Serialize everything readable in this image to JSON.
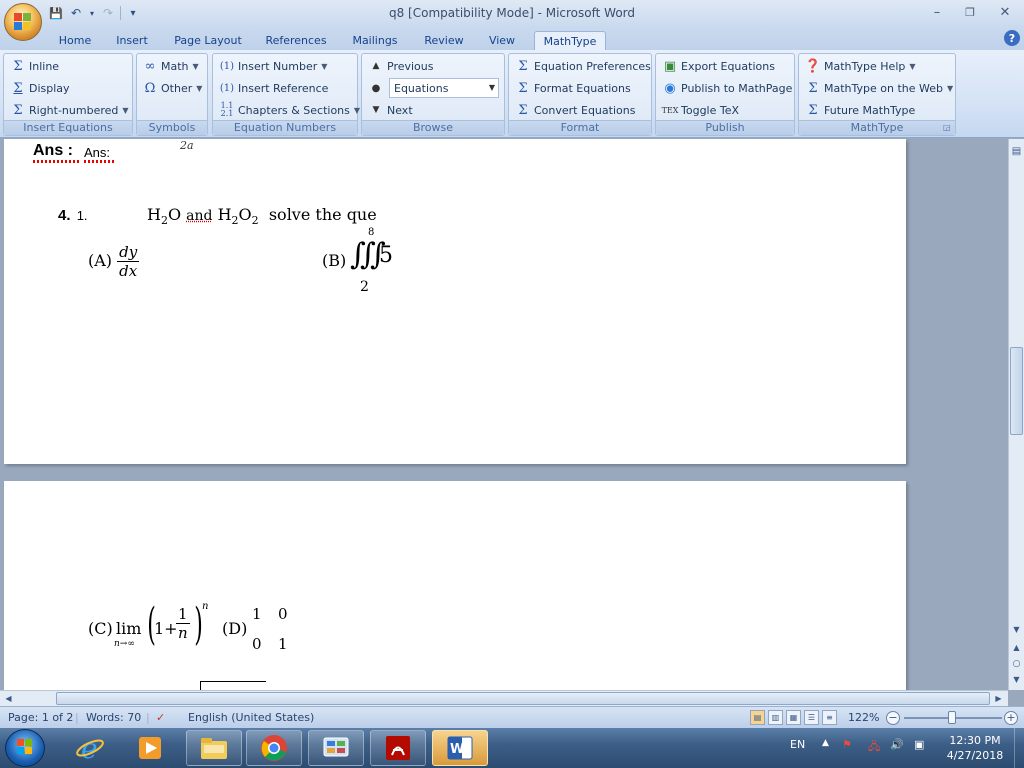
{
  "window": {
    "title": "q8 [Compatibility Mode] - Microsoft Word",
    "minimize": "–",
    "restore": "❐",
    "close": "✕"
  },
  "qat": {
    "save": "💾",
    "undo": "↶",
    "redo": "↷",
    "customize": "▾"
  },
  "tabs": [
    {
      "label": "Home"
    },
    {
      "label": "Insert"
    },
    {
      "label": "Page Layout"
    },
    {
      "label": "References"
    },
    {
      "label": "Mailings"
    },
    {
      "label": "Review"
    },
    {
      "label": "View"
    },
    {
      "label": "MathType"
    }
  ],
  "ribbon": {
    "insert_equations": {
      "label": "Insert Equations",
      "inline": "Inline",
      "display": "Display",
      "right_numbered": "Right-numbered"
    },
    "symbols": {
      "label": "Symbols",
      "math": "Math",
      "other": "Other"
    },
    "equation_numbers": {
      "label": "Equation Numbers",
      "insert_number": "Insert Number",
      "insert_reference": "Insert Reference",
      "chapters_sections": "Chapters & Sections"
    },
    "browse": {
      "label": "Browse",
      "previous": "Previous",
      "combo_value": "Equations",
      "next": "Next"
    },
    "format": {
      "label": "Format",
      "equation_preferences": "Equation Preferences",
      "format_equations": "Format Equations",
      "convert_equations": "Convert Equations"
    },
    "publish": {
      "label": "Publish",
      "export_equations": "Export Equations",
      "publish_mathpage": "Publish to MathPage",
      "toggle_tex": "Toggle TeX"
    },
    "mathtype": {
      "label": "MathType",
      "help": "MathType Help",
      "on_web": "MathType on the Web",
      "future": "Future MathType"
    }
  },
  "document": {
    "ans_label": "Ans :",
    "ans_text": "Ans:",
    "fragment": "2a",
    "question_number": "4.",
    "question_sub": "1.",
    "q_h": "H",
    "q_2a": "2",
    "q_o": "O",
    "q_and": "and",
    "q_h2": "H",
    "q_2b": "2",
    "q_o2": "O",
    "q_2c": "2",
    "q_rest": "solve the que",
    "option_a_label": "(A)",
    "option_a_num": "dy",
    "option_a_den": "dx",
    "option_b_label": "(B)",
    "option_b_upper": "8",
    "option_b_lower": "2",
    "option_b_integrals": "∭",
    "option_b_value": "5",
    "option_c_label": "(C)",
    "option_c_lim": "lim",
    "option_c_sub": "n→∞",
    "option_c_one": "1+",
    "option_c_num": "1",
    "option_c_den": "n",
    "option_c_exp": "n",
    "option_d_label": "(D)",
    "matrix": [
      [
        "1",
        "0"
      ],
      [
        "0",
        "1"
      ]
    ]
  },
  "status": {
    "page": "Page: 1 of 2",
    "words": "Words: 70",
    "language": "English (United States)",
    "zoom": "122%",
    "zoom_level": 0.5
  },
  "taskbar": {
    "lang": "EN",
    "time": "12:30 PM",
    "date": "4/27/2018"
  },
  "colors": {
    "ribbon_bg": "#dde8f6",
    "accent": "#15428b",
    "spellcheck": "#e00000"
  }
}
